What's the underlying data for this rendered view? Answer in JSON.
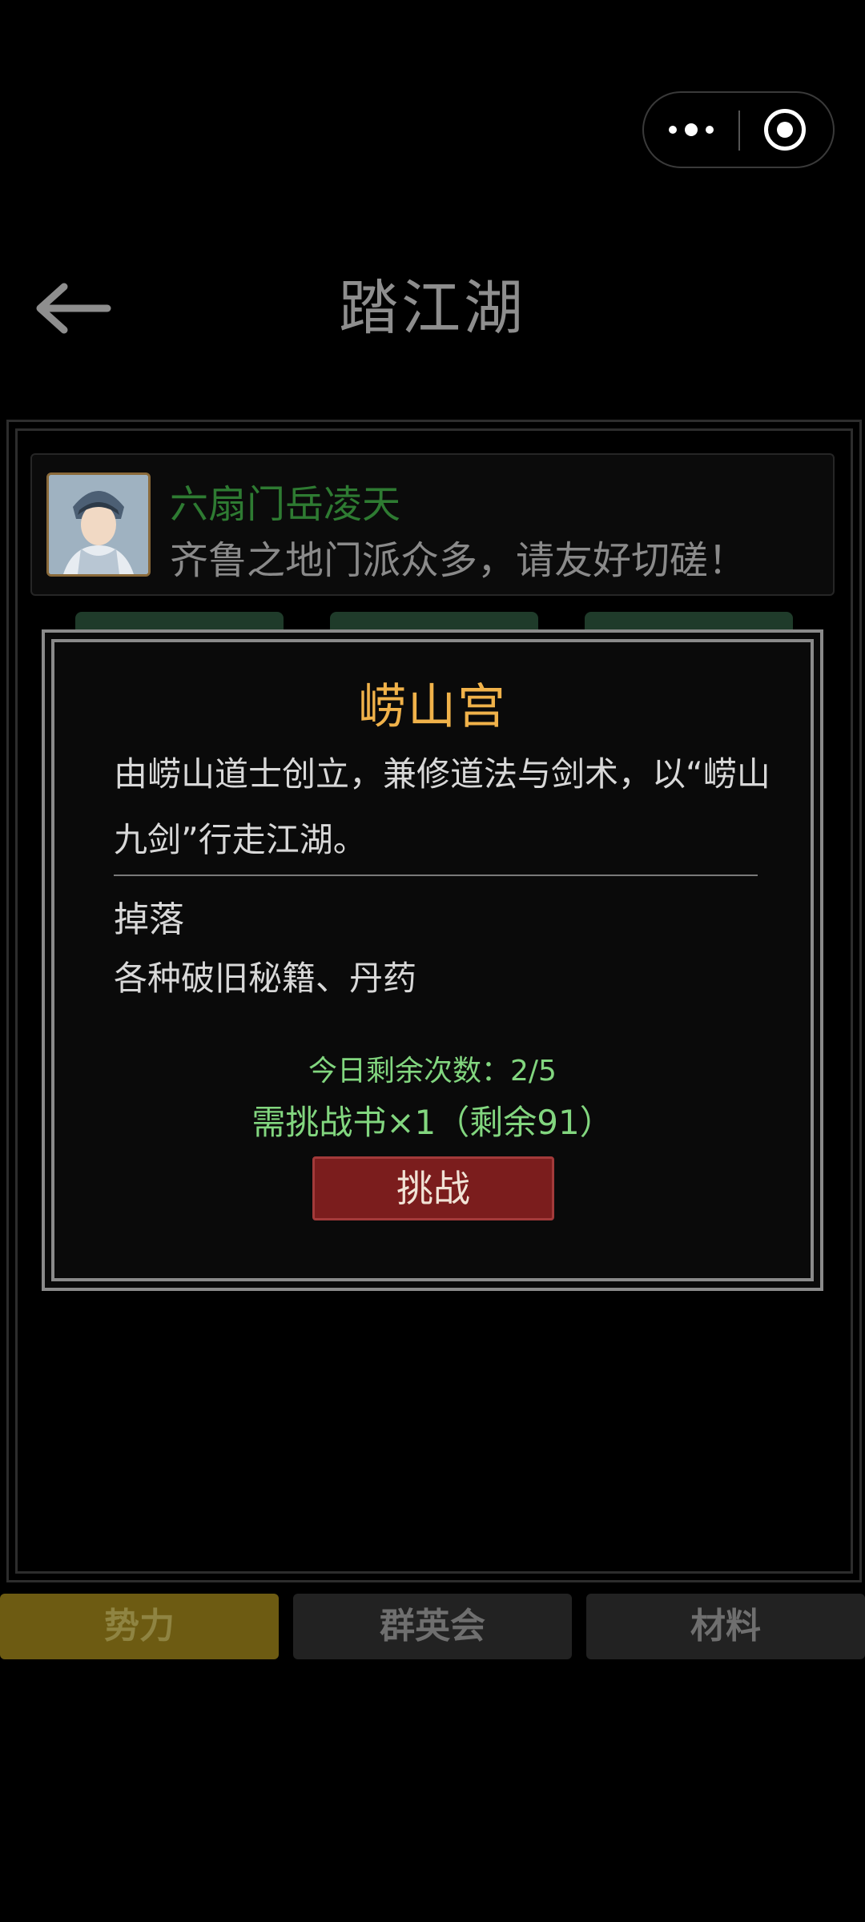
{
  "header": {
    "title": "踏江湖"
  },
  "npc": {
    "name": "六扇门岳凌天",
    "message": "齐鲁之地门派众多，请友好切磋！"
  },
  "modal": {
    "title": "崂山宫",
    "description": "由崂山道士创立，兼修道法与剑术，以“崂山九剑”行走江湖。",
    "drops_title": "掉落",
    "drops_content": "各种破旧秘籍、丹药",
    "remaining": "今日剩余次数：2/5",
    "requirement": "需挑战书×1（剩余91）",
    "challenge_label": "挑战"
  },
  "bottom_tabs": {
    "faction": "势力",
    "heroes": "群英会",
    "materials": "材料",
    "active": "势力"
  },
  "colors": {
    "title_gold": "#f0b24a",
    "green_text": "#82d67f",
    "button_red": "#7b1d1d",
    "active_tab": "#6d5b12"
  }
}
